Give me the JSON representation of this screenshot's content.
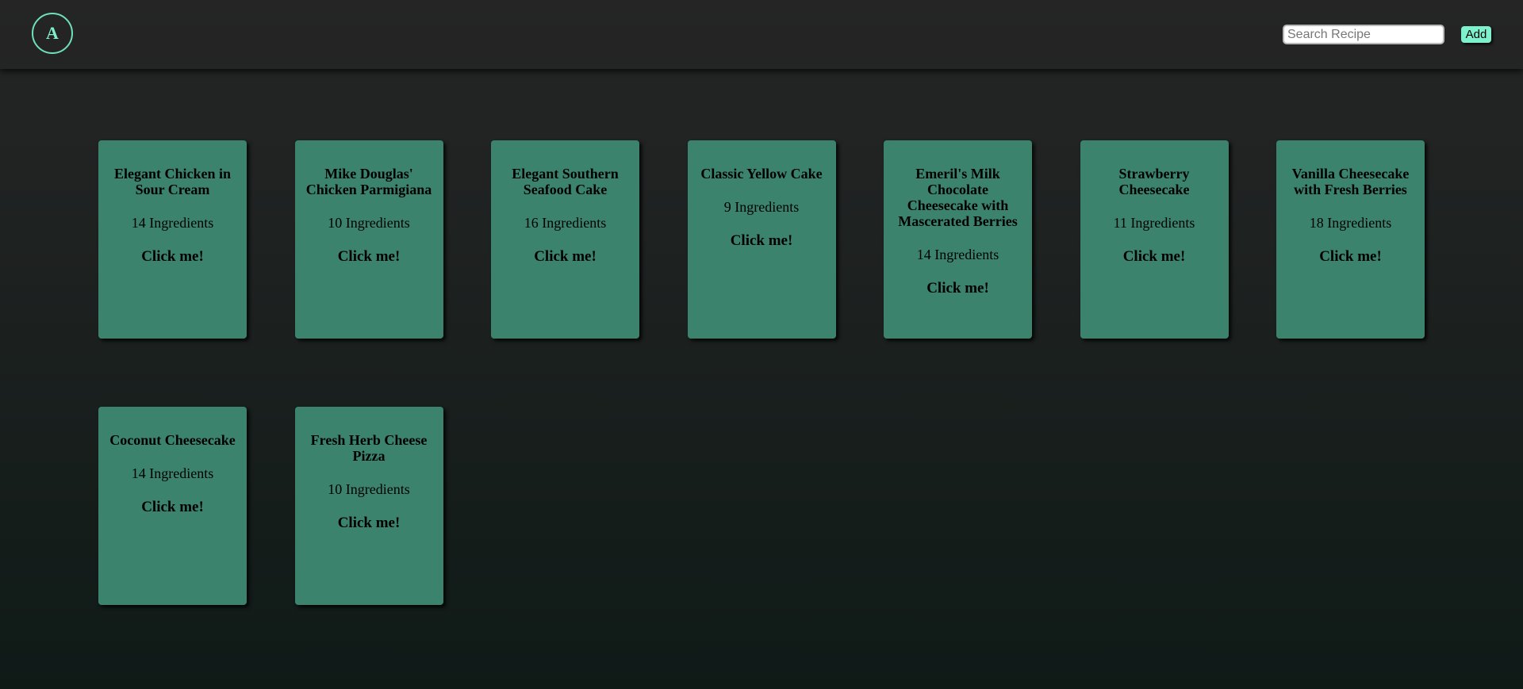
{
  "header": {
    "logo_letter": "A",
    "search_placeholder": "Search Recipe",
    "search_value": "",
    "add_label": "Add"
  },
  "colors": {
    "accent": "#7ff0cc",
    "card": "#3b836c",
    "header": "#252525"
  },
  "recipes": [
    {
      "title": "Elegant Chicken in Sour Cream",
      "ingredients": "14 Ingredients",
      "cta": "Click me!"
    },
    {
      "title": "Mike Douglas' Chicken Parmigiana",
      "ingredients": "10 Ingredients",
      "cta": "Click me!"
    },
    {
      "title": "Elegant Southern Seafood Cake",
      "ingredients": "16 Ingredients",
      "cta": "Click me!"
    },
    {
      "title": "Classic Yellow Cake",
      "ingredients": "9 Ingredients",
      "cta": "Click me!"
    },
    {
      "title": "Emeril's Milk Chocolate Cheesecake with Mascerated Berries",
      "ingredients": "14 Ingredients",
      "cta": "Click me!"
    },
    {
      "title": "Strawberry Cheesecake",
      "ingredients": "11 Ingredients",
      "cta": "Click me!"
    },
    {
      "title": "Vanilla Cheesecake with Fresh Berries",
      "ingredients": "18 Ingredients",
      "cta": "Click me!"
    },
    {
      "title": "Coconut Cheesecake",
      "ingredients": "14 Ingredients",
      "cta": "Click me!"
    },
    {
      "title": "Fresh Herb Cheese Pizza",
      "ingredients": "10 Ingredients",
      "cta": "Click me!"
    }
  ]
}
